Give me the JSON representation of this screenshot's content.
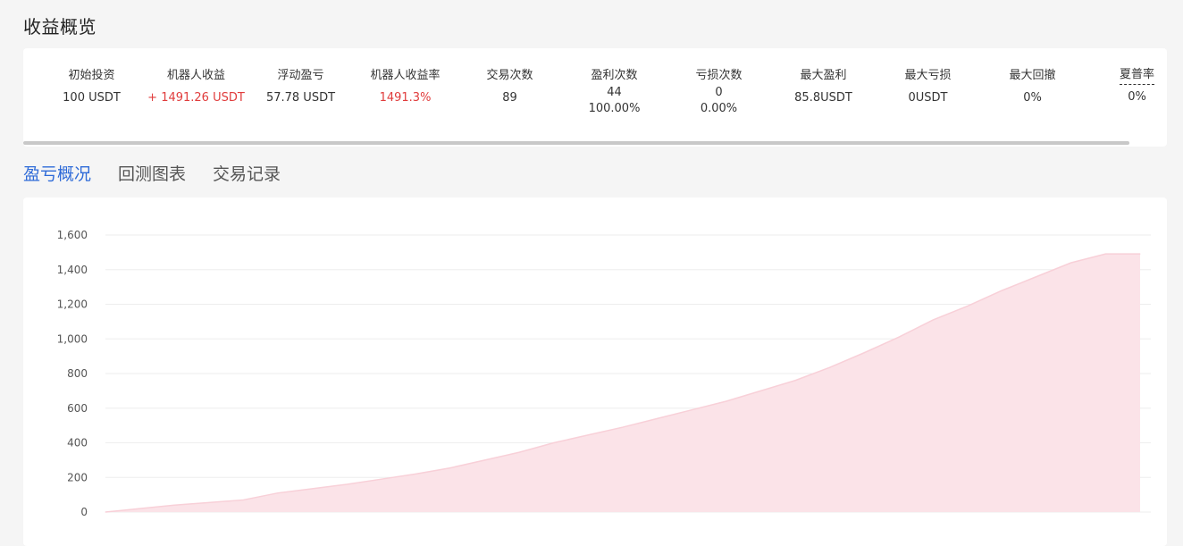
{
  "page": {
    "title": "收益概览"
  },
  "stats": [
    {
      "key": "initial",
      "label": "初始投资",
      "value": "100 USDT"
    },
    {
      "key": "bot_profit",
      "label": "机器人收益",
      "value": "+ 1491.26 USDT",
      "highlight": true
    },
    {
      "key": "floating_pnl",
      "label": "浮动盈亏",
      "value": "57.78 USDT"
    },
    {
      "key": "bot_profit_rate",
      "label": "机器人收益率",
      "value": "1491.3%",
      "highlight": true
    },
    {
      "key": "trades",
      "label": "交易次数",
      "value": "89"
    },
    {
      "key": "wins",
      "label": "盈利次数",
      "value": "44",
      "sub": "100.00%"
    },
    {
      "key": "losses",
      "label": "亏损次数",
      "value": "0",
      "sub": "0.00%"
    },
    {
      "key": "max_profit",
      "label": "最大盈利",
      "value": "85.8USDT"
    },
    {
      "key": "max_loss",
      "label": "最大亏损",
      "value": "0USDT"
    },
    {
      "key": "max_drawdown",
      "label": "最大回撤",
      "value": "0%"
    },
    {
      "key": "sharpe",
      "label": "夏普率",
      "value": "0%",
      "dotted": true
    }
  ],
  "tabs": [
    {
      "label": "盈亏概况",
      "active": true
    },
    {
      "label": "回测图表",
      "active": false
    },
    {
      "label": "交易记录",
      "active": false
    }
  ],
  "colors": {
    "accent": "#2f6bd8",
    "profit": "#e03c3c",
    "area_fill": "#fbe3e8",
    "area_line": "#f8d0d8"
  },
  "chart_data": {
    "type": "area",
    "title": "",
    "xlabel": "",
    "ylabel": "",
    "ylim": [
      0,
      1600
    ],
    "yticks": [
      0,
      200,
      400,
      600,
      800,
      1000,
      1200,
      1400,
      1600
    ],
    "ytick_labels": [
      "0",
      "200",
      "400",
      "600",
      "800",
      "1,000",
      "1,200",
      "1,400",
      "1,600"
    ],
    "grid": true,
    "x": [
      0,
      1,
      2,
      3,
      4,
      5,
      6,
      7,
      8,
      9,
      10,
      11,
      12,
      13,
      14,
      15,
      16,
      17,
      18,
      19,
      20,
      21,
      22,
      23,
      24,
      25,
      26,
      27,
      28,
      29,
      30
    ],
    "values": [
      0,
      20,
      40,
      55,
      70,
      110,
      135,
      160,
      190,
      220,
      255,
      300,
      345,
      400,
      445,
      490,
      540,
      590,
      640,
      700,
      760,
      835,
      920,
      1010,
      1110,
      1190,
      1280,
      1360,
      1440,
      1491,
      1491
    ]
  }
}
